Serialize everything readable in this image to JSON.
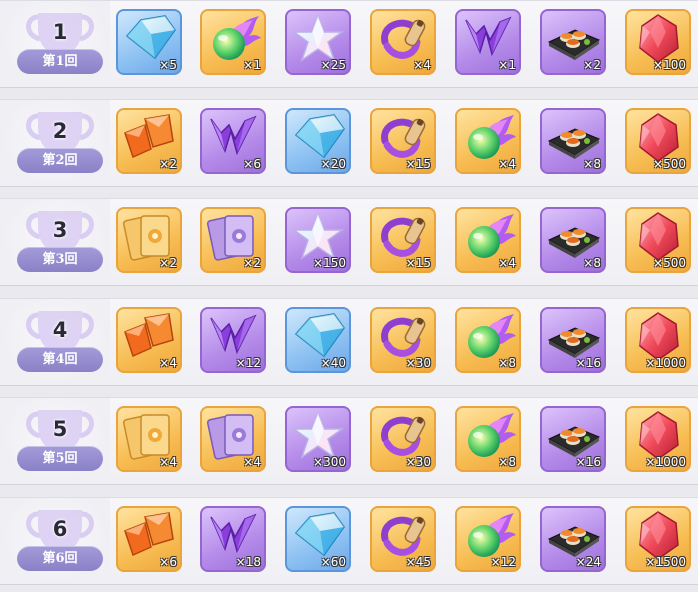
{
  "rows": [
    {
      "rank": "1",
      "label": "第1回",
      "items": [
        {
          "icon": "crystal-icon",
          "qty": "×5"
        },
        {
          "icon": "spirit-orb-icon",
          "qty": "×1"
        },
        {
          "icon": "prism-star-icon",
          "qty": "×25"
        },
        {
          "icon": "bead-necklace-icon",
          "qty": "×4"
        },
        {
          "icon": "purple-shard-icon",
          "qty": "×1"
        },
        {
          "icon": "sushi-platter-icon",
          "qty": "×2"
        },
        {
          "icon": "red-gem-icon",
          "qty": "×100"
        }
      ]
    },
    {
      "rank": "2",
      "label": "第2回",
      "items": [
        {
          "icon": "orange-shard-icon",
          "qty": "×2"
        },
        {
          "icon": "purple-shard-icon",
          "qty": "×6"
        },
        {
          "icon": "crystal-icon",
          "qty": "×20"
        },
        {
          "icon": "bead-necklace-icon",
          "qty": "×15"
        },
        {
          "icon": "spirit-orb-icon",
          "qty": "×4"
        },
        {
          "icon": "sushi-platter-icon",
          "qty": "×8"
        },
        {
          "icon": "red-gem-icon",
          "qty": "×500"
        }
      ]
    },
    {
      "rank": "3",
      "label": "第3回",
      "items": [
        {
          "icon": "gold-card-icon",
          "qty": "×2"
        },
        {
          "icon": "purple-card-icon",
          "qty": "×2"
        },
        {
          "icon": "prism-star-icon",
          "qty": "×150"
        },
        {
          "icon": "bead-necklace-icon",
          "qty": "×15"
        },
        {
          "icon": "spirit-orb-icon",
          "qty": "×4"
        },
        {
          "icon": "sushi-platter-icon",
          "qty": "×8"
        },
        {
          "icon": "red-gem-icon",
          "qty": "×500"
        }
      ]
    },
    {
      "rank": "4",
      "label": "第4回",
      "items": [
        {
          "icon": "orange-shard-icon",
          "qty": "×4"
        },
        {
          "icon": "purple-shard-icon",
          "qty": "×12"
        },
        {
          "icon": "crystal-icon",
          "qty": "×40"
        },
        {
          "icon": "bead-necklace-icon",
          "qty": "×30"
        },
        {
          "icon": "spirit-orb-icon",
          "qty": "×8"
        },
        {
          "icon": "sushi-platter-icon",
          "qty": "×16"
        },
        {
          "icon": "red-gem-icon",
          "qty": "×1000"
        }
      ]
    },
    {
      "rank": "5",
      "label": "第5回",
      "items": [
        {
          "icon": "gold-card-icon",
          "qty": "×4"
        },
        {
          "icon": "purple-card-icon",
          "qty": "×4"
        },
        {
          "icon": "prism-star-icon",
          "qty": "×300"
        },
        {
          "icon": "bead-necklace-icon",
          "qty": "×30"
        },
        {
          "icon": "spirit-orb-icon",
          "qty": "×8"
        },
        {
          "icon": "sushi-platter-icon",
          "qty": "×16"
        },
        {
          "icon": "red-gem-icon",
          "qty": "×1000"
        }
      ]
    },
    {
      "rank": "6",
      "label": "第6回",
      "items": [
        {
          "icon": "orange-shard-icon",
          "qty": "×6"
        },
        {
          "icon": "purple-shard-icon",
          "qty": "×18"
        },
        {
          "icon": "crystal-icon",
          "qty": "×60"
        },
        {
          "icon": "bead-necklace-icon",
          "qty": "×45"
        },
        {
          "icon": "spirit-orb-icon",
          "qty": "×12"
        },
        {
          "icon": "sushi-platter-icon",
          "qty": "×24"
        },
        {
          "icon": "red-gem-icon",
          "qty": "×1500"
        }
      ]
    }
  ]
}
